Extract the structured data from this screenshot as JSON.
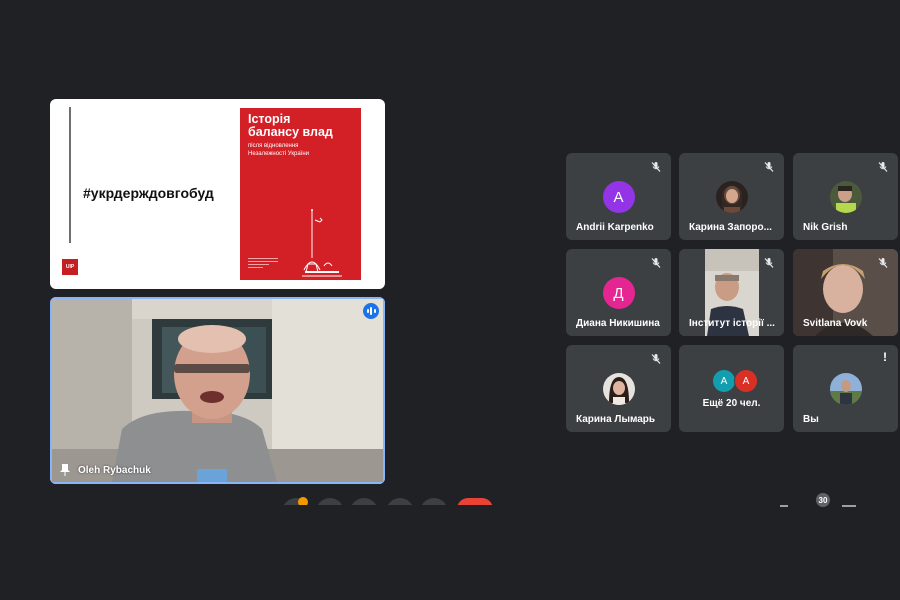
{
  "presentation": {
    "hashtag": "#укрдерждовгобуд",
    "logo_text": "UIP",
    "book": {
      "title_line1": "Історія",
      "title_line2": "балансу влад",
      "subtitle_line1": "після відновлення",
      "subtitle_line2": "Незалежності України"
    }
  },
  "speaker": {
    "name": "Oleh Rybachuk",
    "pin_icon": "pin-icon",
    "audio_icon": "audio-level-icon"
  },
  "participants": [
    {
      "name": "Andrii Karpenko",
      "avatar_letter": "A",
      "avatar_color": "#9334e6",
      "muted": true
    },
    {
      "name": "Карина Запоро...",
      "avatar_type": "photo",
      "muted": true
    },
    {
      "name": "Nik Grish",
      "avatar_type": "photo",
      "muted": true
    },
    {
      "name": "Диана Никишина",
      "avatar_letter": "Д",
      "avatar_color": "#e52592",
      "muted": true
    },
    {
      "name": "Інститут історії ...",
      "avatar_type": "video",
      "muted": true
    },
    {
      "name": "Svitlana Vovk",
      "avatar_type": "video",
      "muted": true
    },
    {
      "name": "Карина Лымарь",
      "avatar_type": "photo",
      "muted": true
    },
    {
      "name": "Ещё 20 чел.",
      "avatar_letters": [
        "A",
        "A"
      ],
      "avatar_colors": [
        "#129eaf",
        "#d93025"
      ]
    },
    {
      "name": "Вы",
      "avatar_type": "photo",
      "alert": "!"
    }
  ],
  "toolbar": {
    "people_count": "30",
    "colors": {
      "hangup": "#ea4335",
      "notification": "#f29900"
    }
  }
}
